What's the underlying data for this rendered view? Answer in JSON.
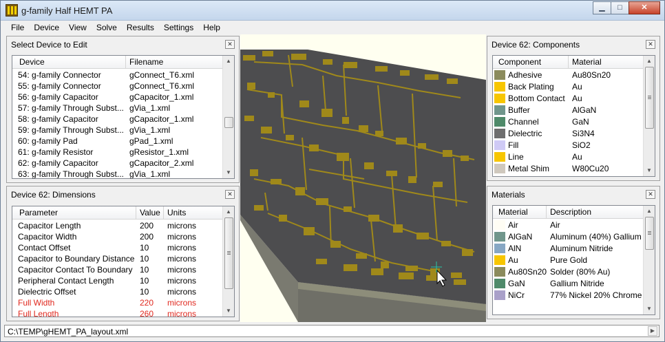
{
  "window": {
    "title": "g-family Half HEMT PA",
    "minimize_glyph": "▁",
    "maximize_glyph": "□",
    "close_glyph": "✕"
  },
  "menu": [
    "File",
    "Device",
    "View",
    "Solve",
    "Results",
    "Settings",
    "Help"
  ],
  "device_panel": {
    "title": "Select Device to Edit",
    "columns": [
      "Device",
      "Filename"
    ],
    "rows": [
      [
        "54: g-family Connector",
        "gConnect_T6.xml"
      ],
      [
        "55: g-family Connector",
        "gConnect_T6.xml"
      ],
      [
        "56: g-family Capacitor",
        "gCapacitor_1.xml"
      ],
      [
        "57: g-family Through Subst...",
        "gVia_1.xml"
      ],
      [
        "58: g-family Capacitor",
        "gCapacitor_1.xml"
      ],
      [
        "59: g-family Through Subst...",
        "gVia_1.xml"
      ],
      [
        "60: g-family Pad",
        "gPad_1.xml"
      ],
      [
        "61: g-family Resistor",
        "gResistor_1.xml"
      ],
      [
        "62: g-family Capacitor",
        "gCapacitor_2.xml"
      ],
      [
        "63: g-family Through Subst...",
        "gVia_1.xml"
      ]
    ]
  },
  "dimensions_panel": {
    "title": "Device  62:  Dimensions",
    "columns": [
      "Parameter",
      "Value",
      "Units"
    ],
    "rows": [
      {
        "param": "Capacitor Length",
        "value": "200",
        "units": "microns",
        "highlight": false
      },
      {
        "param": "Capacitor Width",
        "value": "200",
        "units": "microns",
        "highlight": false
      },
      {
        "param": "Contact Offset",
        "value": "10",
        "units": "microns",
        "highlight": false
      },
      {
        "param": "Capacitor to Boundary Distance",
        "value": "10",
        "units": "microns",
        "highlight": false
      },
      {
        "param": "Capacitor Contact To Boundary",
        "value": "10",
        "units": "microns",
        "highlight": false
      },
      {
        "param": "Peripheral Contact Length",
        "value": "10",
        "units": "microns",
        "highlight": false
      },
      {
        "param": "Dielectric Offset",
        "value": "10",
        "units": "microns",
        "highlight": false
      },
      {
        "param": "Full Width",
        "value": "220",
        "units": "microns",
        "highlight": true
      },
      {
        "param": "Full Length",
        "value": "260",
        "units": "microns",
        "highlight": true
      }
    ]
  },
  "components_panel": {
    "title": "Device  62:  Components",
    "columns": [
      "Component",
      "Material"
    ],
    "rows": [
      {
        "component": "Adhesive",
        "material": "Au80Sn20",
        "color": "#8b8b5c"
      },
      {
        "component": "Back Plating",
        "material": "Au",
        "color": "#f7c600"
      },
      {
        "component": "Bottom Contact",
        "material": "Au",
        "color": "#f7c600"
      },
      {
        "component": "Buffer",
        "material": "AlGaN",
        "color": "#70968c"
      },
      {
        "component": "Channel",
        "material": "GaN",
        "color": "#4f8a6a"
      },
      {
        "component": "Dielectric",
        "material": "Si3N4",
        "color": "#6e6e6e"
      },
      {
        "component": "Fill",
        "material": "SiO2",
        "color": "#cfcaf5"
      },
      {
        "component": "Line",
        "material": "Au",
        "color": "#f7c600"
      },
      {
        "component": "Metal Shim",
        "material": "W80Cu20",
        "color": "#cfc8bd"
      }
    ]
  },
  "materials_panel": {
    "title": "Materials",
    "columns": [
      "Material",
      "Description"
    ],
    "rows": [
      {
        "material": "Air",
        "description": "Air",
        "color": "#fffdf4"
      },
      {
        "material": "AlGaN",
        "description": "Aluminum (40%) Gallium",
        "color": "#70968c"
      },
      {
        "material": "AlN",
        "description": "Aluminum Nitride",
        "color": "#87a7c4"
      },
      {
        "material": "Au",
        "description": "Pure Gold",
        "color": "#f7c600"
      },
      {
        "material": "Au80Sn20",
        "description": "Solder (80% Au)",
        "color": "#8b8b5c"
      },
      {
        "material": "GaN",
        "description": "Gallium Nitride",
        "color": "#4f8a6a"
      },
      {
        "material": "NiCr",
        "description": "77% Nickel 20% Chrome",
        "color": "#a9a0c9"
      }
    ]
  },
  "status": {
    "file_path": "C:\\TEMP\\gHEMT_PA_layout.xml"
  },
  "colors": {
    "chip_top": "#4d4d4f",
    "chip_side": "#7a7a70",
    "trace_gold": "#a0891a",
    "viewport_bg": "#fffff0"
  }
}
